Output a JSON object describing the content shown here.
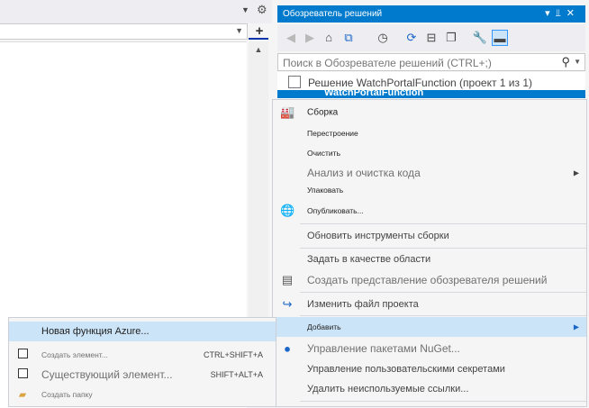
{
  "left_pane": {
    "toolbar_dropdown_icon": "dropdown-arrow",
    "toolbar_settings_icon": "gear-icon",
    "combo_value": "",
    "split_button_label": "+",
    "scroll_up_label": "▲"
  },
  "solution_explorer": {
    "title": "Обозреватель решений",
    "title_controls": [
      "▾",
      "⫫",
      "✕"
    ],
    "search_placeholder": "Поиск в Обозревателе решений (CTRL+;)",
    "solution_label": "Решение WatchPortalFunction (проект 1 из 1)",
    "project_label": "WatchPortalFunction",
    "toolbar_icons": [
      "back-icon",
      "forward-icon",
      "home-icon",
      "switch-views-icon",
      "pending-changes-icon",
      "sync-icon",
      "collapse-all-icon",
      "show-all-files-icon",
      "properties-icon",
      "preview-icon"
    ]
  },
  "context_menu": {
    "items": [
      {
        "label": "Сборка",
        "icon": "build-icon"
      },
      {
        "label": "Перестроение"
      },
      {
        "label": "Очистить"
      },
      {
        "label": "Анализ и очистка кода",
        "arrow": "▶"
      },
      {
        "label": "Упаковать"
      },
      {
        "label": "Опубликовать...",
        "icon": "publish-icon"
      },
      {
        "label": "Обновить инструменты сборки"
      },
      {
        "label": "Задать в качестве области"
      },
      {
        "label": "Создать представление обозревателя решений",
        "icon": "new-view-icon"
      },
      {
        "label": "Изменить файл проекта",
        "icon": "edit-project-icon"
      },
      {
        "label": "Добавить",
        "arrow": "▶"
      },
      {
        "label": "Управление пакетами NuGet...",
        "icon": "nuget-icon"
      },
      {
        "label": "Управление пользовательскими секретами"
      },
      {
        "label": "Удалить неиспользуемые ссылки..."
      }
    ]
  },
  "submenu": {
    "items": [
      {
        "label": "Новая функция Azure..."
      },
      {
        "label": "Создать элемент...",
        "shortcut": "CTRL+SHIFT+A",
        "icon": "new-item-icon"
      },
      {
        "label": "Существующий элемент...",
        "shortcut": "SHIFT+ALT+A",
        "icon": "existing-item-icon"
      },
      {
        "label": "Создать папку",
        "icon": "new-folder-icon"
      }
    ]
  },
  "colors": {
    "accent": "#007acc",
    "highlight": "#cce4f7",
    "menu_bg": "#f5f5f5"
  }
}
